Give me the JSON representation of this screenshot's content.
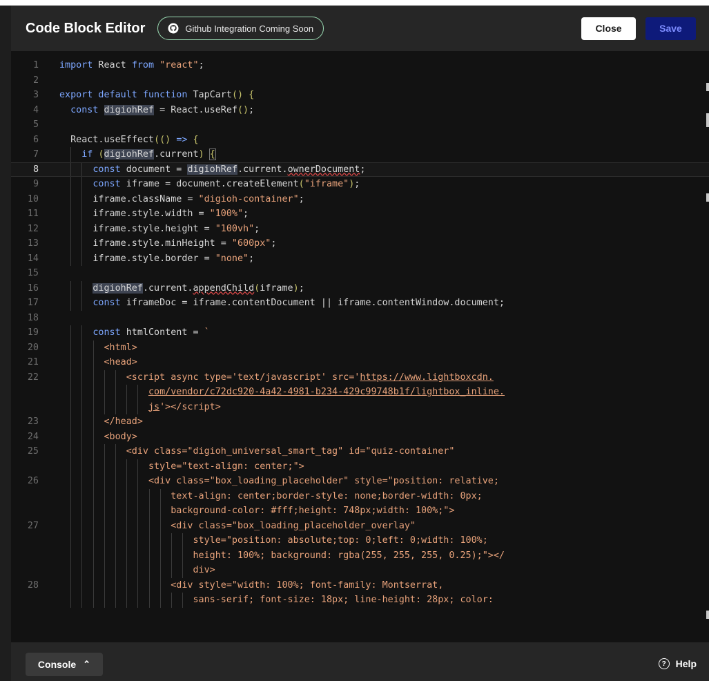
{
  "header": {
    "title": "Code Block Editor",
    "github_pill": "Github Integration Coming Soon",
    "close_label": "Close",
    "save_label": "Save"
  },
  "footer": {
    "console_label": "Console",
    "help_label": "Help"
  },
  "editor": {
    "active_line": 8,
    "lines": [
      {
        "n": "1",
        "html": "<span class='kw'>import</span> React <span class='kw'>from</span> <span class='str'>\"react\"</span>;"
      },
      {
        "n": "2",
        "html": ""
      },
      {
        "n": "3",
        "html": "<span class='kw'>export default function</span> TapCart<span class='par'>()</span> <span class='par'>{</span>"
      },
      {
        "n": "4",
        "html": "  <span class='kw'>const</span> <span class='hl'>digiohRef</span> = React.useRef<span class='par'>()</span>;"
      },
      {
        "n": "5",
        "html": ""
      },
      {
        "n": "6",
        "html": "  React.useEffect<span class='par'>(()</span> <span class='kw'>=&gt;</span> <span class='par'>{</span>"
      },
      {
        "n": "7",
        "html": "    <span class='kw'>if</span> <span class='par'>(</span><span class='hl'>digiohRef</span>.current<span class='par'>)</span> <span class='par' style='outline:1px solid #777'>{</span>"
      },
      {
        "n": "8",
        "html": "      <span class='kw'>const</span> document = <span class='hl'>digiohRef</span>.current.<span class='squig'>ownerDocument</span>;"
      },
      {
        "n": "9",
        "html": "      <span class='kw'>const</span> iframe = document.createElement<span class='par'>(</span><span class='str'>\"iframe\"</span><span class='par'>)</span>;"
      },
      {
        "n": "10",
        "html": "      iframe.className = <span class='str'>\"digioh-container\"</span>;"
      },
      {
        "n": "11",
        "html": "      iframe.style.width = <span class='str'>\"100%\"</span>;"
      },
      {
        "n": "12",
        "html": "      iframe.style.height = <span class='str'>\"100vh\"</span>;"
      },
      {
        "n": "13",
        "html": "      iframe.style.minHeight = <span class='str'>\"600px\"</span>;"
      },
      {
        "n": "14",
        "html": "      iframe.style.border = <span class='str'>\"none\"</span>;"
      },
      {
        "n": "15",
        "html": ""
      },
      {
        "n": "16",
        "html": "      <span class='hl'>digiohRef</span>.current.<span class='squig'>appendChild</span><span class='par'>(</span>iframe<span class='par'>)</span>;"
      },
      {
        "n": "17",
        "html": "      <span class='kw'>const</span> iframeDoc = iframe.contentDocument || iframe.contentWindow.document;"
      },
      {
        "n": "18",
        "html": ""
      },
      {
        "n": "19",
        "html": "      <span class='kw'>const</span> htmlContent = <span class='str'>`</span>"
      },
      {
        "n": "20",
        "html": "        <span class='tag'>&lt;html&gt;</span>"
      },
      {
        "n": "21",
        "html": "        <span class='tag'>&lt;head&gt;</span>"
      },
      {
        "n": "22",
        "html": "            <span class='tag'>&lt;script async type='text/javascript' src='<span class='url'>https://www.lightboxcdn.</span></span>"
      },
      {
        "n": "",
        "html": "                <span class='url'>com/vendor/c72dc920-4a42-4981-b234-429c99748b1f/lightbox_inline.</span>"
      },
      {
        "n": "",
        "html": "                <span class='tag'><span class='url'>js</span>'&gt;&lt;/script&gt;</span>"
      },
      {
        "n": "23",
        "html": "        <span class='tag'>&lt;/head&gt;</span>"
      },
      {
        "n": "24",
        "html": "        <span class='tag'>&lt;body&gt;</span>"
      },
      {
        "n": "25",
        "html": "            <span class='tag'>&lt;div class=\"digioh_universal_smart_tag\" id=\"quiz-container\"</span>"
      },
      {
        "n": "",
        "html": "                <span class='tag'>style=\"text-align: center;\"&gt;</span>"
      },
      {
        "n": "26",
        "html": "                <span class='tag'>&lt;div class=\"box_loading_placeholder\" style=\"position: relative;</span>"
      },
      {
        "n": "",
        "html": "                    <span class='tag'>text-align: center;border-style: none;border-width: 0px;</span>"
      },
      {
        "n": "",
        "html": "                    <span class='tag'>background-color: #fff;height: 748px;width: 100%;\"&gt;</span>"
      },
      {
        "n": "27",
        "html": "                    <span class='tag'>&lt;div class=\"box_loading_placeholder_overlay\"</span>"
      },
      {
        "n": "",
        "html": "                        <span class='tag'>style=\"position: absolute;top: 0;left: 0;width: 100%;</span>"
      },
      {
        "n": "",
        "html": "                        <span class='tag'>height: 100%; background: rgba(255, 255, 255, 0.25);\"&gt;&lt;/</span>"
      },
      {
        "n": "",
        "html": "                        <span class='tag'>div&gt;</span>"
      },
      {
        "n": "28",
        "html": "                    <span class='tag'>&lt;div style=\"width: 100%; font-family: Montserrat,</span>"
      },
      {
        "n": "",
        "html": "                        <span class='tag'>sans-serif; font-size: 18px; line-height: 28px; color:</span>"
      }
    ]
  }
}
